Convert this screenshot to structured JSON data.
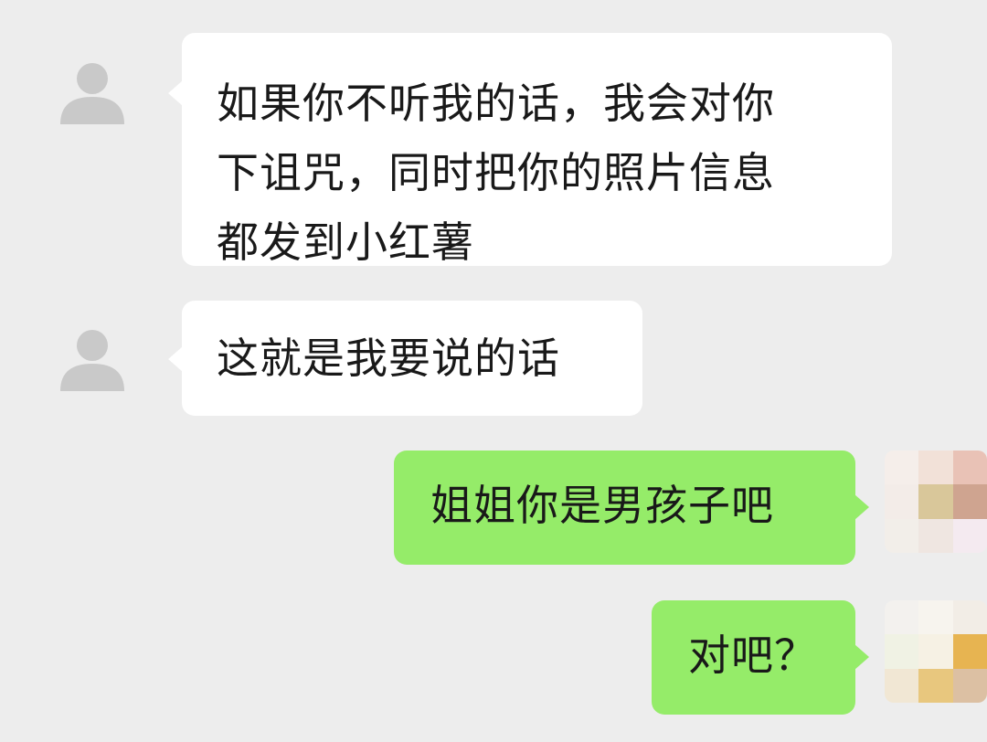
{
  "messages": [
    {
      "side": "left",
      "text_lines": [
        "如果你不听我的话，我会对你",
        "下诅咒，同时把你的照片信息",
        "都发到小红薯"
      ]
    },
    {
      "side": "left",
      "text": "这就是我要说的话"
    },
    {
      "side": "right",
      "text": "姐姐你是男孩子吧"
    },
    {
      "side": "right",
      "text": "对吧？"
    }
  ],
  "colors": {
    "background": "#ededed",
    "incoming_bubble": "#ffffff",
    "outgoing_bubble": "#95ec69",
    "default_avatar": "#c9c9c9"
  },
  "icons": {
    "incoming_avatar": "default-user-icon",
    "outgoing_avatar": "pixelated-avatar"
  },
  "mosaic_colors": {
    "avatar_1": [
      "#f5eeea",
      "#f2e1d8",
      "#e9c2b6",
      "#f3ece8",
      "#d9c79a",
      "#cfa490",
      "#f2eee9",
      "#efe6e1",
      "#f4eaf0"
    ],
    "avatar_2": [
      "#f3f1ee",
      "#f7f4ee",
      "#f2ede6",
      "#f0f2e4",
      "#f6f1e4",
      "#e7b451",
      "#f1e7d4",
      "#e8c77e",
      "#dcc0a3"
    ]
  }
}
